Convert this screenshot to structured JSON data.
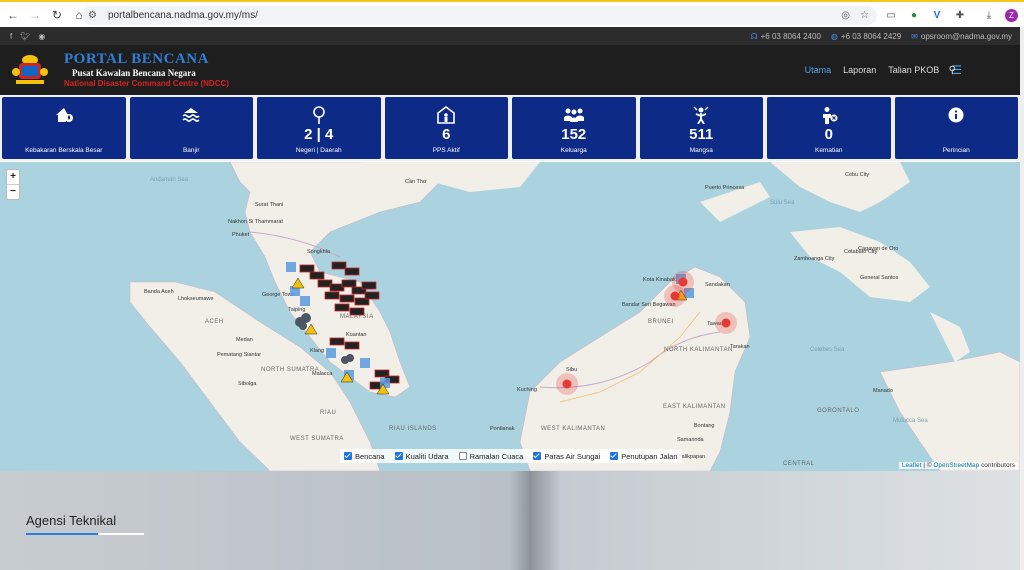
{
  "browser": {
    "url": "portalbencana.nadma.gov.my/ms/",
    "profile_initial": "Z"
  },
  "topbar": {
    "phone1": "+6 03 8064 2400",
    "phone2": "+6 03 8064 2429",
    "email": "opsroom@nadma.gov.my"
  },
  "brand": {
    "title": "PORTAL BENCANA",
    "subtitle": "Pusat Kawalan Bencana Negara",
    "subtitle_en": "National Disaster Command Centre (NDCC)"
  },
  "menu": {
    "items": [
      "Utama",
      "Laporan",
      "Talian PKOB"
    ]
  },
  "stats": [
    {
      "label": "Kebakaran Berskala Besar",
      "value": "",
      "icon": "house-fire-icon"
    },
    {
      "label": "Banjir",
      "value": "",
      "icon": "water-icon"
    },
    {
      "label": "Negeri | Daerah",
      "value": "2 | 4",
      "icon": "map-pin-icon"
    },
    {
      "label": "PPS Aktif",
      "value": "6",
      "icon": "shelter-icon"
    },
    {
      "label": "Keluarga",
      "value": "152",
      "icon": "family-icon"
    },
    {
      "label": "Mangsa",
      "value": "511",
      "icon": "victim-icon"
    },
    {
      "label": "Kematian",
      "value": "0",
      "icon": "death-icon"
    },
    {
      "label": "Perincian",
      "value": "",
      "icon": "info-icon"
    }
  ],
  "map": {
    "zoom_in": "+",
    "zoom_out": "−",
    "legend": [
      {
        "label": "Bencana",
        "checked": true
      },
      {
        "label": "Kualiti Udara",
        "checked": true
      },
      {
        "label": "Ramalan Cuaca",
        "checked": false
      },
      {
        "label": "Paras Air Sungai",
        "checked": true
      },
      {
        "label": "Penutupan Jalan",
        "checked": true
      }
    ],
    "attribution_leaflet": "Leaflet",
    "attribution_sep": "| ©",
    "attribution_osm": "OpenStreetMap",
    "attribution_tail": "contributors",
    "labels": {
      "andaman": "Andaman Sea",
      "can_tho": "Cần Thơ",
      "puerto": "Puerto Princesa",
      "cebu": "Cebu City",
      "surat": "Surat Thani",
      "nakhon": "Nakhon Si Thammarat",
      "phuket": "Phuket",
      "songkhla": "Songkhla",
      "cagayan": "Cagayan de Oro",
      "zamboanga": "Zamboanga City",
      "cotabato": "Cotabato City",
      "gensan": "General Santos",
      "banda": "Banda Aceh",
      "lhokseumawe": "Lhokseumawe",
      "george": "George Town",
      "kota_kinabalu": "Kota Kinabalu",
      "sandakan": "Sandakan",
      "bsb": "Bandar Seri Begawan",
      "brunei": "BRUNEI",
      "aceh": "ACEH",
      "medan": "Medan",
      "taiping": "Taiping",
      "kuantan": "Kuantan",
      "pematang": "Pematang Siantar",
      "sibolga": "Sibolga",
      "klang": "Klang",
      "malacca": "Malacca",
      "north_sumatra": "NORTH SUMATRA",
      "north_kal": "NORTH KALIMANTAN",
      "tawau": "Tawau",
      "tarakan": "Tarakan",
      "sibu": "Sibu",
      "kuching": "Kuching",
      "riau": "RIAU",
      "riau_islands": "RIAU ISLANDS",
      "west_sumatra": "WEST SUMATRA",
      "pontianak": "Pontianak",
      "west_kal": "WEST KALIMANTAN",
      "east_kal": "EAST KALIMANTAN",
      "bontang": "Bontang",
      "samarinda": "Samarinda",
      "balikpapan": "Balikpapan",
      "gorontalo": "GORONTALO",
      "manado": "Manado",
      "celebes": "Celebes Sea",
      "molucca": "Molucca Sea",
      "sulu": "Sulu Sea",
      "central": "CENTRAL",
      "malaysia": "MALAYSIA"
    }
  },
  "section": {
    "title": "Agensi Teknikal"
  }
}
